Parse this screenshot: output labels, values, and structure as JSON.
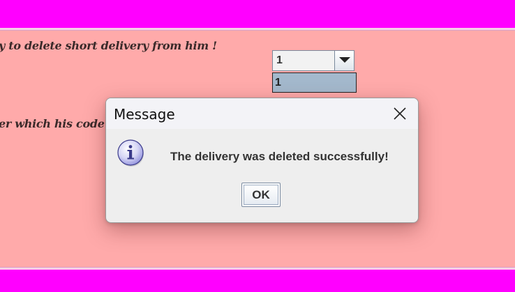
{
  "background": {
    "instruction_line_1": "y to delete short delivery from him !",
    "instruction_line_2": "er which his code is",
    "colors": {
      "banner": "#ff00ff",
      "panel": "#ffaaaa"
    }
  },
  "combo": {
    "selected_value": "1",
    "options": [
      "1"
    ],
    "highlighted_option": "1"
  },
  "dialog": {
    "title": "Message",
    "icon": "info-icon",
    "message": "The delivery was deleted successfully!",
    "ok_label": "OK",
    "close_icon": "close-icon"
  }
}
